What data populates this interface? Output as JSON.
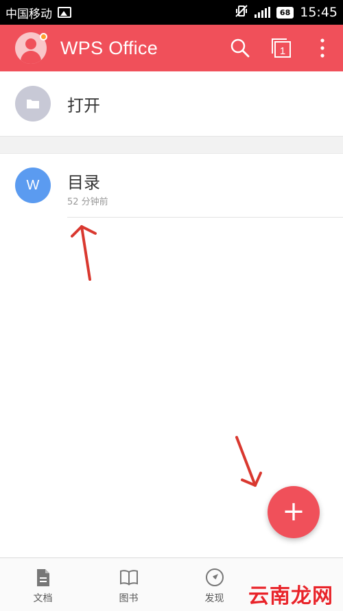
{
  "status_bar": {
    "carrier": "中国移动",
    "battery": "68",
    "time": "15:45"
  },
  "app_bar": {
    "title": "WPS Office",
    "window_count": "1",
    "icons": [
      "search-icon",
      "windows-icon",
      "more-vert-icon"
    ]
  },
  "open": {
    "label": "打开",
    "icon": "folder-icon"
  },
  "recent": [
    {
      "name": "目录",
      "time": "52 分钟前",
      "icon_letter": "W"
    }
  ],
  "fab": {
    "symbol": "+"
  },
  "bottom_nav": [
    {
      "label": "文档",
      "icon": "document-icon"
    },
    {
      "label": "图书",
      "icon": "book-icon"
    },
    {
      "label": "发现",
      "icon": "compass-icon"
    },
    {
      "label": "",
      "icon": ""
    }
  ],
  "watermark": "云南龙网",
  "colors": {
    "brand": "#f0505a",
    "doc_icon": "#5b9bf0",
    "arrow": "#d9382f"
  }
}
